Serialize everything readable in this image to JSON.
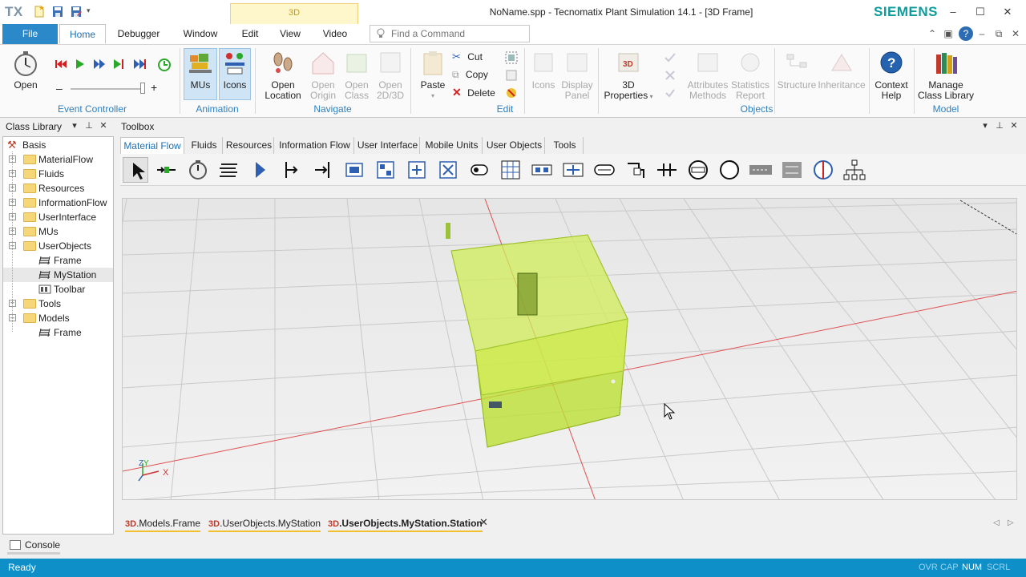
{
  "titlebar": {
    "logo": "TX",
    "context_tab": "3D",
    "title": "NoName.spp - Tecnomatix Plant Simulation 14.1 - [3D Frame]",
    "brand": "SIEMENS",
    "minimize": "–",
    "maximize": "☐",
    "close": "✕"
  },
  "ribbon_tabs": {
    "file": "File",
    "tabs": [
      "Home",
      "Debugger",
      "Window",
      "Edit",
      "View",
      "Video"
    ],
    "active": "Home",
    "find_placeholder": "Find a Command"
  },
  "ribbon": {
    "event_controller": {
      "open": "Open",
      "group": "Event Controller",
      "slider_minus": "–",
      "slider_plus": "+"
    },
    "animation": {
      "mus": "MUs",
      "icons": "Icons",
      "group": "Animation"
    },
    "navigate": {
      "open_location": [
        "Open",
        "Location"
      ],
      "open_origin": [
        "Open",
        "Origin"
      ],
      "open_class": [
        "Open",
        "Class"
      ],
      "open_2d3d": [
        "Open",
        "2D/3D"
      ],
      "group": "Navigate"
    },
    "edit": {
      "paste": "Paste",
      "cut": "Cut",
      "copy": "Copy",
      "delete": "Delete",
      "group": "Edit"
    },
    "objects": {
      "icons": "Icons",
      "display_panel": [
        "Display",
        "Panel"
      ],
      "properties_3d": [
        "3D",
        "Properties"
      ],
      "attributes_methods": [
        "Attributes",
        "Methods"
      ],
      "statistics_report": [
        "Statistics",
        "Report"
      ],
      "structure": "Structure",
      "inheritance": "Inheritance",
      "context_help": [
        "Context",
        "Help"
      ],
      "group": "Objects"
    },
    "model": {
      "manage": [
        "Manage",
        "Class Library"
      ],
      "group": "Model"
    }
  },
  "class_library": {
    "title": "Class Library",
    "items": [
      {
        "label": "Basis",
        "level": 0,
        "kind": "root"
      },
      {
        "label": "MaterialFlow",
        "level": 1,
        "kind": "folder",
        "exp": "+"
      },
      {
        "label": "Fluids",
        "level": 1,
        "kind": "folder",
        "exp": "+"
      },
      {
        "label": "Resources",
        "level": 1,
        "kind": "folder",
        "exp": "+"
      },
      {
        "label": "InformationFlow",
        "level": 1,
        "kind": "folder",
        "exp": "+"
      },
      {
        "label": "UserInterface",
        "level": 1,
        "kind": "folder",
        "exp": "+"
      },
      {
        "label": "MUs",
        "level": 1,
        "kind": "folder",
        "exp": "+"
      },
      {
        "label": "UserObjects",
        "level": 1,
        "kind": "folder",
        "exp": "–"
      },
      {
        "label": "Frame",
        "level": 2,
        "kind": "frame"
      },
      {
        "label": "MyStation",
        "level": 2,
        "kind": "frame"
      },
      {
        "label": "Toolbar",
        "level": 2,
        "kind": "toolbar"
      },
      {
        "label": "Tools",
        "level": 1,
        "kind": "folder",
        "exp": "+"
      },
      {
        "label": "Models",
        "level": 1,
        "kind": "folder",
        "exp": "–"
      },
      {
        "label": "Frame",
        "level": 2,
        "kind": "frame"
      }
    ]
  },
  "toolbox": {
    "title": "Toolbox",
    "tabs": [
      "Material Flow",
      "Fluids",
      "Resources",
      "Information Flow",
      "User Interface",
      "Mobile Units",
      "User Objects",
      "Tools"
    ],
    "active_tab": "Material Flow",
    "icons": [
      "pointer",
      "connector",
      "event-controller",
      "frame",
      "source",
      "entrance",
      "drain",
      "singleproc",
      "parallelproc",
      "assembly",
      "dismantle",
      "store",
      "cycle",
      "buffer",
      "sorter",
      "placebuffer",
      "line",
      "angular-converter",
      "turntable",
      "turnplate",
      "transfer-station",
      "track",
      "interface",
      "flow-control",
      "shift",
      "exit",
      "hierarchy"
    ]
  },
  "doc_tabs": [
    {
      "prefix": "3D",
      "label": ".Models.Frame",
      "active": false
    },
    {
      "prefix": "3D",
      "label": ".UserObjects.MyStation",
      "active": false
    },
    {
      "prefix": "3D",
      "label": ".UserObjects.MyStation.Station",
      "active": true
    }
  ],
  "doc_close": "✕",
  "console": {
    "label": "Console"
  },
  "status": {
    "text": "Ready",
    "indicators": [
      {
        "label": "OVR",
        "on": false
      },
      {
        "label": "CAP",
        "on": false
      },
      {
        "label": "NUM",
        "on": true
      },
      {
        "label": "SCRL",
        "on": false
      }
    ]
  },
  "axes": {
    "z": "Z",
    "y": "Y",
    "x": "X"
  },
  "colors": {
    "accent": "#2b88c9",
    "status_bar": "#0f8fc7",
    "group_label": "#2e7fbf",
    "siemens": "#0e9c9a",
    "station_fill": "#c6ea3c"
  }
}
